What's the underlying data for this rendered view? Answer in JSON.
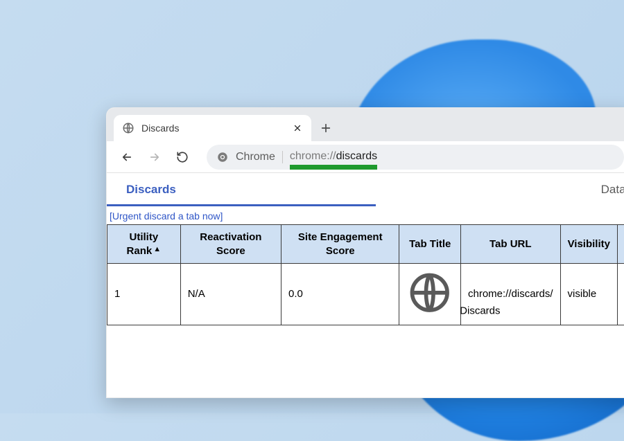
{
  "browser": {
    "tab": {
      "title": "Discards"
    },
    "new_tab_tooltip": "New tab",
    "nav": {
      "back": "Back",
      "forward": "Forward",
      "reload": "Reload"
    },
    "omnibox": {
      "origin_label": "Chrome",
      "url_dim": "chrome://",
      "url_bold": "discards"
    }
  },
  "page": {
    "tabs": {
      "primary": "Discards",
      "secondary": "Datab"
    },
    "urgent_link": "[Urgent discard a tab now]",
    "columns": {
      "utility_rank": "Utility Rank",
      "reactivation_score": "Reactivation Score",
      "site_engagement_score": "Site Engagement Score",
      "tab_title": "Tab Title",
      "tab_url": "Tab URL",
      "visibility": "Visibility"
    },
    "rows": [
      {
        "utility_rank": "1",
        "reactivation_score": "N/A",
        "site_engagement_score": "0.0",
        "tab_title": "Discards",
        "tab_url": "chrome://discards/",
        "visibility": "visible"
      }
    ]
  }
}
